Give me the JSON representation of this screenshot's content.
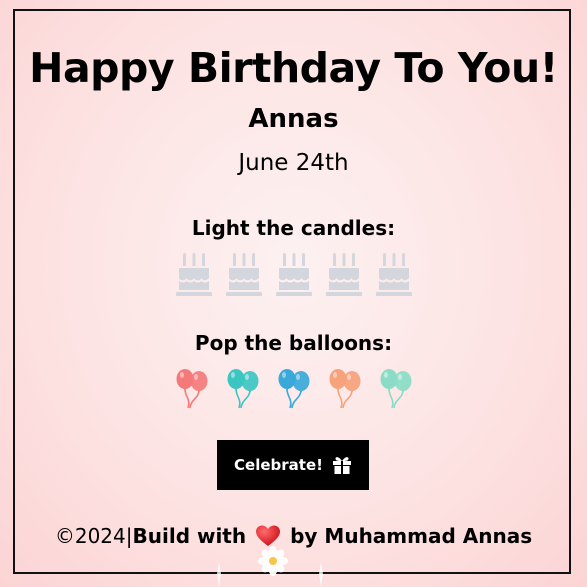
{
  "page": {
    "title": "Happy Birthday To You!",
    "name": "Annas",
    "date": "June 24th"
  },
  "candles": {
    "label": "Light the candles:",
    "count": 5,
    "icon": "birthday-cake-icon",
    "color": "#d3d6dd"
  },
  "balloons": {
    "label": "Pop the balloons:",
    "icon": "balloons-icon",
    "colors": [
      "#f47a7a",
      "#3cc6c2",
      "#3aa8d8",
      "#f6a27a",
      "#8adcc6"
    ]
  },
  "button": {
    "label": "Celebrate!",
    "icon": "gift-icon"
  },
  "footer": {
    "copyright": "©2024|",
    "build": "Build with",
    "heart_icon": "heart-icon",
    "by": "by Muhammad Annas"
  },
  "colors": {
    "background": "#fde3e3",
    "button_bg": "#000000",
    "heart": "#e8242f"
  }
}
